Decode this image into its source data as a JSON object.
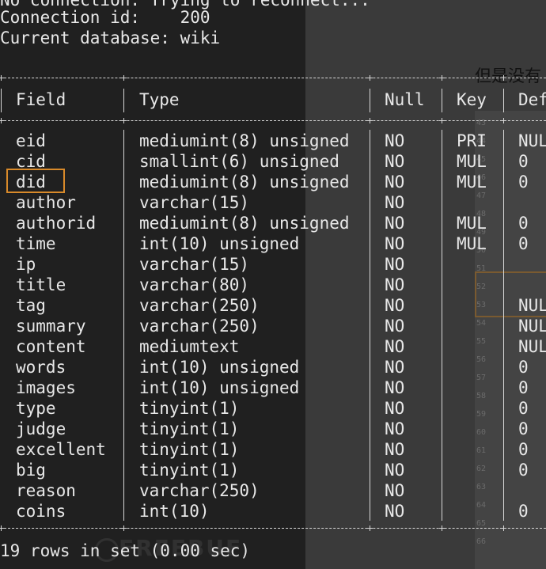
{
  "terminal": {
    "lines": {
      "reconnect": "No connection. Trying to reconnect...",
      "connection_id": "Connection id:    200",
      "current_db": "Current database: wiki"
    },
    "table": {
      "headers": [
        "Field",
        "Type",
        "Null",
        "Key",
        "Def"
      ],
      "rows": [
        {
          "field": "eid",
          "type": "mediumint(8) unsigned",
          "null": "NO",
          "key": "PRI",
          "default": "NUL"
        },
        {
          "field": "cid",
          "type": "smallint(6) unsigned",
          "null": "NO",
          "key": "MUL",
          "default": "0"
        },
        {
          "field": "did",
          "type": "mediumint(8) unsigned",
          "null": "NO",
          "key": "MUL",
          "default": "0"
        },
        {
          "field": "author",
          "type": "varchar(15)",
          "null": "NO",
          "key": "",
          "default": ""
        },
        {
          "field": "authorid",
          "type": "mediumint(8) unsigned",
          "null": "NO",
          "key": "MUL",
          "default": "0"
        },
        {
          "field": "time",
          "type": "int(10) unsigned",
          "null": "NO",
          "key": "MUL",
          "default": "0"
        },
        {
          "field": "ip",
          "type": "varchar(15)",
          "null": "NO",
          "key": "",
          "default": ""
        },
        {
          "field": "title",
          "type": "varchar(80)",
          "null": "NO",
          "key": "",
          "default": ""
        },
        {
          "field": "tag",
          "type": "varchar(250)",
          "null": "NO",
          "key": "",
          "default": "NUL"
        },
        {
          "field": "summary",
          "type": "varchar(250)",
          "null": "NO",
          "key": "",
          "default": "NUL"
        },
        {
          "field": "content",
          "type": "mediumtext",
          "null": "NO",
          "key": "",
          "default": "NUL"
        },
        {
          "field": "words",
          "type": "int(10) unsigned",
          "null": "NO",
          "key": "",
          "default": "0"
        },
        {
          "field": "images",
          "type": "int(10) unsigned",
          "null": "NO",
          "key": "",
          "default": "0"
        },
        {
          "field": "type",
          "type": "tinyint(1)",
          "null": "NO",
          "key": "",
          "default": "0"
        },
        {
          "field": "judge",
          "type": "tinyint(1)",
          "null": "NO",
          "key": "",
          "default": "0"
        },
        {
          "field": "excellent",
          "type": "tinyint(1)",
          "null": "NO",
          "key": "",
          "default": "0"
        },
        {
          "field": "big",
          "type": "tinyint(1)",
          "null": "NO",
          "key": "",
          "default": "0"
        },
        {
          "field": "reason",
          "type": "varchar(250)",
          "null": "NO",
          "key": "",
          "default": ""
        },
        {
          "field": "coins",
          "type": "int(10)",
          "null": "NO",
          "key": "",
          "default": "0"
        }
      ],
      "highlighted_field": "did",
      "footer": "19 rows in set (0.00 sec)"
    }
  },
  "background": {
    "cjk_text": "但是没有",
    "line_numbers": [
      "43",
      "44",
      "45",
      "46",
      "47",
      "48",
      "49",
      "50",
      "51",
      "52",
      "53",
      "54",
      "55",
      "56",
      "57",
      "58",
      "59",
      "60",
      "61",
      "62",
      "63",
      "64",
      "65",
      "66"
    ],
    "watermark": "FREEBUF"
  },
  "colors": {
    "terminal_bg": "#202020",
    "terminal_text": "#e8e8e8",
    "highlight_box": "#d98a2a"
  }
}
